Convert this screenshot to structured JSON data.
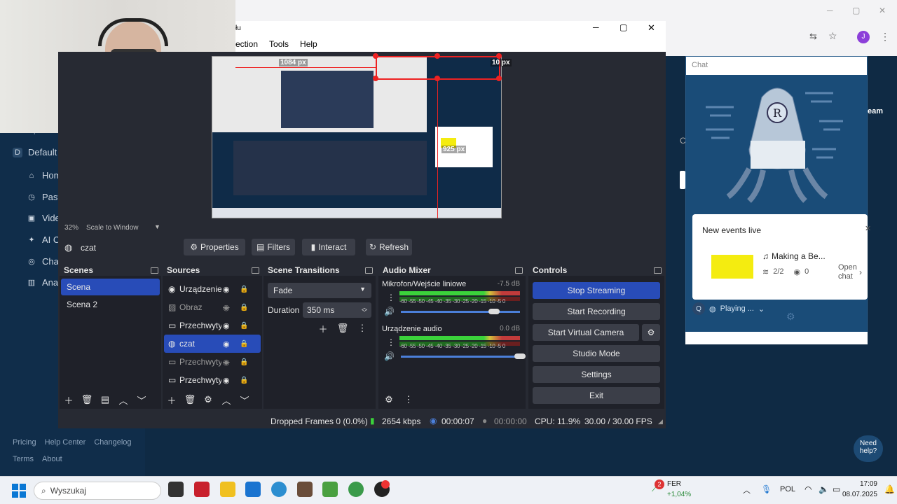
{
  "background_app": {
    "sidebar_items": [
      {
        "icon": "d-badge-icon",
        "label": "Default"
      },
      {
        "icon": "home-icon",
        "label": "Hom"
      },
      {
        "icon": "clock-icon",
        "label": "Past"
      },
      {
        "icon": "video-icon",
        "label": "Vide"
      },
      {
        "icon": "spark-icon",
        "label": "AI C"
      },
      {
        "icon": "chat-icon",
        "label": "Char"
      },
      {
        "icon": "chart-icon",
        "label": "Anal"
      }
    ],
    "workspaces_text": "Workspaces",
    "footer_links": [
      "Pricing",
      "Help Center",
      "Changelog",
      "Terms",
      "About"
    ],
    "need_help": "Need help?",
    "team_text": "eam",
    "c_text": "C"
  },
  "chat": {
    "title": "Chat",
    "events_title": "New events live",
    "event_name": "Making a Be...",
    "event_count": "2/2",
    "viewers": "0",
    "open_chat": "Open chat",
    "playing": "Playing ..."
  },
  "obs": {
    "title_fragment": "łu",
    "menu": [
      "ection",
      "Tools",
      "Help"
    ],
    "preview_labels": {
      "width_label": "1084 px",
      "right_label": "10 px",
      "height_label": "925 px"
    },
    "zoom": "32%",
    "scale_mode": "Scale to Window",
    "source_name": "czat",
    "context_buttons": [
      "Properties",
      "Filters",
      "Interact",
      "Refresh"
    ],
    "docks": {
      "scenes": "Scenes",
      "sources": "Sources",
      "transitions": "Scene Transitions",
      "mixer": "Audio Mixer",
      "controls": "Controls"
    },
    "scenes": [
      "Scena",
      "Scena 2"
    ],
    "sources": [
      {
        "icon": "camera-icon",
        "name": "Urządzenie",
        "visible": true
      },
      {
        "icon": "image-icon",
        "name": "Obraz",
        "visible": false
      },
      {
        "icon": "monitor-icon",
        "name": "Przechwyty",
        "visible": true
      },
      {
        "icon": "browser-icon",
        "name": "czat",
        "visible": true
      },
      {
        "icon": "monitor-icon",
        "name": "Przechwyty",
        "visible": false
      },
      {
        "icon": "monitor-icon",
        "name": "Przechwyty",
        "visible": true
      }
    ],
    "transition": {
      "type": "Fade",
      "duration_label": "Duration",
      "duration": "350 ms"
    },
    "mixer": [
      {
        "name": "Mikrofon/Wejście liniowe",
        "db": "-7.5 dB",
        "volume": 0.78
      },
      {
        "name": "Urządzenie audio",
        "db": "0.0 dB",
        "volume": 1.0
      }
    ],
    "meter_scale": "-60 -55 -50 -45 -40 -35 -30 -25 -20 -15 -10 -5 0",
    "controls": [
      "Stop Streaming",
      "Start Recording",
      "Start Virtual Camera",
      "Studio Mode",
      "Settings",
      "Exit"
    ],
    "status": {
      "dropped": "Dropped Frames 0 (0.0%)",
      "bitrate": "2654 kbps",
      "stream_time": "00:00:07",
      "rec_time": "00:00:00",
      "cpu": "CPU: 11.9%",
      "fps": "30.00 / 30.00 FPS"
    }
  },
  "taskbar": {
    "search": "Wyszukaj",
    "stock_name": "FER",
    "stock_change": "+1,04%",
    "lang": "POL",
    "time": "17:09",
    "date": "08.07.2025",
    "notif_count": "2"
  },
  "colors": {
    "accent": "#284cb8",
    "obs_bg": "#272a33",
    "dock_bg": "#1f2129",
    "browser_bg": "#0f2a44"
  }
}
